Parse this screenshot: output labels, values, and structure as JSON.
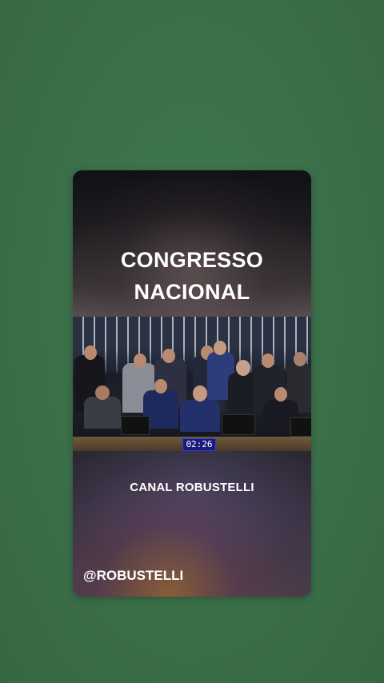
{
  "story": {
    "title_line1": "CONGRESSO",
    "title_line2": "NACIONAL",
    "video": {
      "timer": "02:26",
      "description_icon": "congress-session-photo"
    },
    "channel_label": "CANAL ROBUSTELLI",
    "handle": "@ROBUSTELLI"
  },
  "colors": {
    "background": "#3c7049",
    "text": "#ffffff",
    "timer_bg": "#1b1b7a"
  }
}
